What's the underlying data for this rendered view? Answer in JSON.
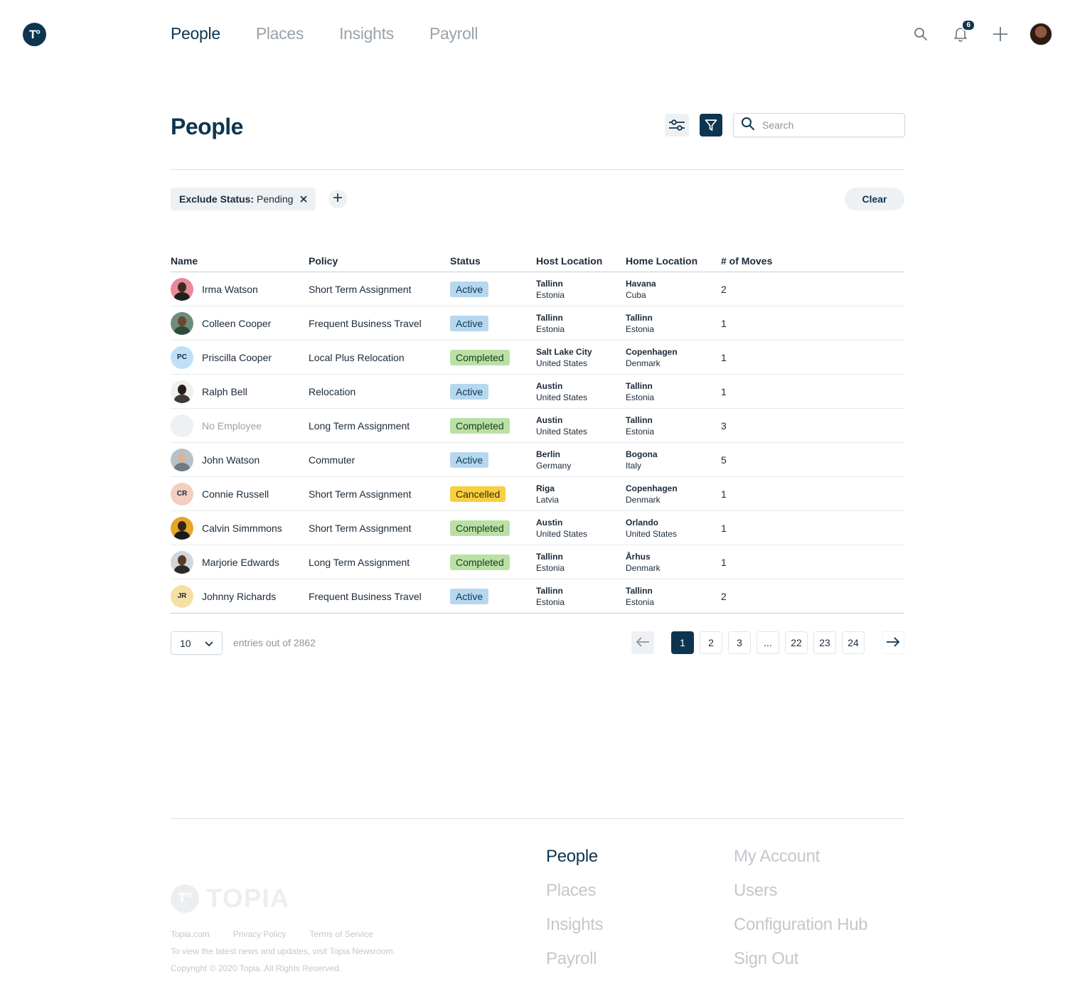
{
  "nav": {
    "logo_text": "T°",
    "items": [
      "People",
      "Places",
      "Insights",
      "Payroll"
    ],
    "notification_count": "6"
  },
  "page": {
    "title": "People",
    "search_placeholder": "Search"
  },
  "filters": {
    "chip_key": "Exclude Status:",
    "chip_value": "Pending",
    "clear_label": "Clear"
  },
  "table": {
    "headers": [
      "Name",
      "Policy",
      "Status",
      "Host Location",
      "Home Location",
      "# of Moves"
    ],
    "rows": [
      {
        "name": "Irma Watson",
        "initials": "",
        "policy": "Short Term Assignment",
        "status": "Active",
        "host_city": "Tallinn",
        "host_country": "Estonia",
        "home_city": "Havana",
        "home_country": "Cuba",
        "moves": "2"
      },
      {
        "name": "Colleen Cooper",
        "initials": "",
        "policy": "Frequent Business Travel",
        "status": "Active",
        "host_city": "Tallinn",
        "host_country": "Estonia",
        "home_city": "Tallinn",
        "home_country": "Estonia",
        "moves": "1"
      },
      {
        "name": "Priscilla Cooper",
        "initials": "PC",
        "policy": "Local Plus Relocation",
        "status": "Completed",
        "host_city": "Salt Lake City",
        "host_country": "United States",
        "home_city": "Copenhagen",
        "home_country": "Denmark",
        "moves": "1"
      },
      {
        "name": "Ralph Bell",
        "initials": "",
        "policy": "Relocation",
        "status": "Active",
        "host_city": "Austin",
        "host_country": "United States",
        "home_city": "Tallinn",
        "home_country": "Estonia",
        "moves": "1"
      },
      {
        "name": "No Employee",
        "initials": "",
        "policy": "Long Term Assignment",
        "status": "Completed",
        "host_city": "Austin",
        "host_country": "United States",
        "home_city": "Tallinn",
        "home_country": "Estonia",
        "moves": "3"
      },
      {
        "name": "John Watson",
        "initials": "",
        "policy": "Commuter",
        "status": "Active",
        "host_city": "Berlin",
        "host_country": "Germany",
        "home_city": "Bogona",
        "home_country": "Italy",
        "moves": "5"
      },
      {
        "name": "Connie Russell",
        "initials": "CR",
        "policy": "Short Term Assignment",
        "status": "Cancelled",
        "host_city": "Riga",
        "host_country": "Latvia",
        "home_city": "Copenhagen",
        "home_country": "Denmark",
        "moves": "1"
      },
      {
        "name": "Calvin Simmmons",
        "initials": "",
        "policy": "Short Term Assignment",
        "status": "Completed",
        "host_city": "Austin",
        "host_country": "United States",
        "home_city": "Orlando",
        "home_country": "United States",
        "moves": "1"
      },
      {
        "name": "Marjorie Edwards",
        "initials": "",
        "policy": "Long Term Assignment",
        "status": "Completed",
        "host_city": "Tallinn",
        "host_country": "Estonia",
        "home_city": "Århus",
        "home_country": "Denmark",
        "moves": "1"
      },
      {
        "name": "Johnny Richards",
        "initials": "JR",
        "policy": "Frequent Business Travel",
        "status": "Active",
        "host_city": "Tallinn",
        "host_country": "Estonia",
        "home_city": "Tallinn",
        "home_country": "Estonia",
        "moves": "2"
      }
    ]
  },
  "pagination": {
    "per_page": "10",
    "entries_text": "entries out of 2862",
    "pages": [
      "1",
      "2",
      "3",
      "...",
      "22",
      "23",
      "24"
    ],
    "current": "1"
  },
  "footer": {
    "brand": "TOPIA",
    "logo_mark": "T°",
    "links": [
      "Topia.com",
      "Privacy Policy",
      "Terms of Service"
    ],
    "news_text": "To view the latest news and updates, visit Topia Newsroom.",
    "copyright": "Copyright © 2020 Topia. All Rights Reserved.",
    "nav_col1": [
      "People",
      "Places",
      "Insights",
      "Payroll"
    ],
    "nav_col2": [
      "My Account",
      "Users",
      "Configuration Hub",
      "Sign Out"
    ]
  },
  "colors": {
    "brand": "#0e3550",
    "status_active": "#b6d7f0",
    "status_completed": "#b9e0a5",
    "status_cancelled": "#f8cf40"
  },
  "icons": [
    "logo-icon",
    "search-icon",
    "bell-icon",
    "plus-icon",
    "avatar",
    "sliders-icon",
    "filter-icon",
    "close-icon",
    "chevron-down-icon",
    "arrow-left-icon",
    "arrow-right-icon"
  ]
}
